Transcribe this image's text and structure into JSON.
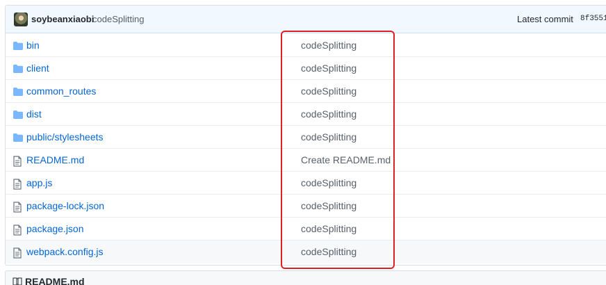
{
  "latest_commit": {
    "author": "soybeanxiaobi",
    "message": "codeSplitting",
    "label": "Latest commit",
    "sha": "8f3551"
  },
  "files": [
    {
      "name": "bin",
      "type": "folder",
      "commit": "codeSplitting",
      "icon": "folder-icon"
    },
    {
      "name": "client",
      "type": "folder",
      "commit": "codeSplitting",
      "icon": "folder-icon"
    },
    {
      "name": "common_routes",
      "type": "folder",
      "commit": "codeSplitting",
      "icon": "folder-icon"
    },
    {
      "name": "dist",
      "type": "folder",
      "commit": "codeSplitting",
      "icon": "folder-icon"
    },
    {
      "name": "public/stylesheets",
      "type": "folder",
      "commit": "codeSplitting",
      "icon": "folder-icon"
    },
    {
      "name": "README.md",
      "type": "file",
      "commit": "Create README.md",
      "icon": "file-text-icon"
    },
    {
      "name": "app.js",
      "type": "file",
      "commit": "codeSplitting",
      "icon": "file-text-icon"
    },
    {
      "name": "package-lock.json",
      "type": "file",
      "commit": "codeSplitting",
      "icon": "file-text-icon"
    },
    {
      "name": "package.json",
      "type": "file",
      "commit": "codeSplitting",
      "icon": "file-text-icon"
    },
    {
      "name": "webpack.config.js",
      "type": "file",
      "commit": "codeSplitting",
      "icon": "file-text-icon"
    }
  ],
  "readme": {
    "label": "README.md",
    "icon": "book-icon"
  },
  "colors": {
    "link_blue": "#0366d6",
    "muted_text": "#586069",
    "commit_bar_background": "#f1f8ff",
    "highlight_red": "#e02020",
    "folder_icon": "#79b8ff",
    "file_icon": "#6a737d"
  }
}
